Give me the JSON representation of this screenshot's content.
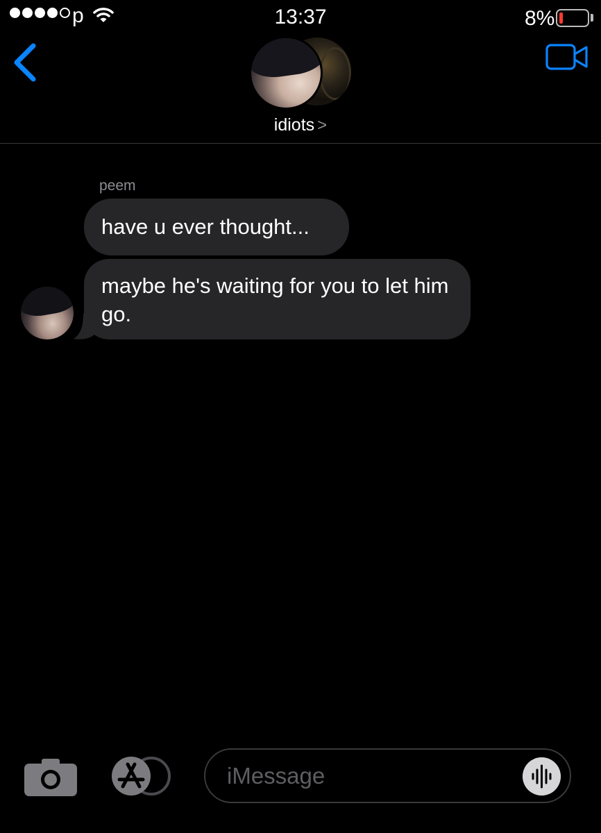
{
  "status_bar": {
    "carrier": "p",
    "time": "13:37",
    "battery_percent": "8%",
    "signal_bars_filled": 4,
    "signal_bars_total": 5,
    "battery_level": 0.08
  },
  "nav": {
    "back_icon": "chevron-left-icon",
    "video_icon": "video-camera-icon",
    "group_name": "idiots",
    "group_chevron": ">"
  },
  "conversation": {
    "sender_name": "peem",
    "messages": [
      {
        "text": "have u ever thought..."
      },
      {
        "text": "maybe he's waiting for you to let him go."
      }
    ]
  },
  "input_bar": {
    "camera_icon": "camera-icon",
    "apps_icon": "app-store-icon",
    "placeholder": "iMessage",
    "audio_icon": "waveform-icon"
  },
  "colors": {
    "background": "#000000",
    "bubble": "#262628",
    "accent": "#0a84ff",
    "secondary_text": "#8e8e93",
    "battery_low": "#ff3b30"
  }
}
